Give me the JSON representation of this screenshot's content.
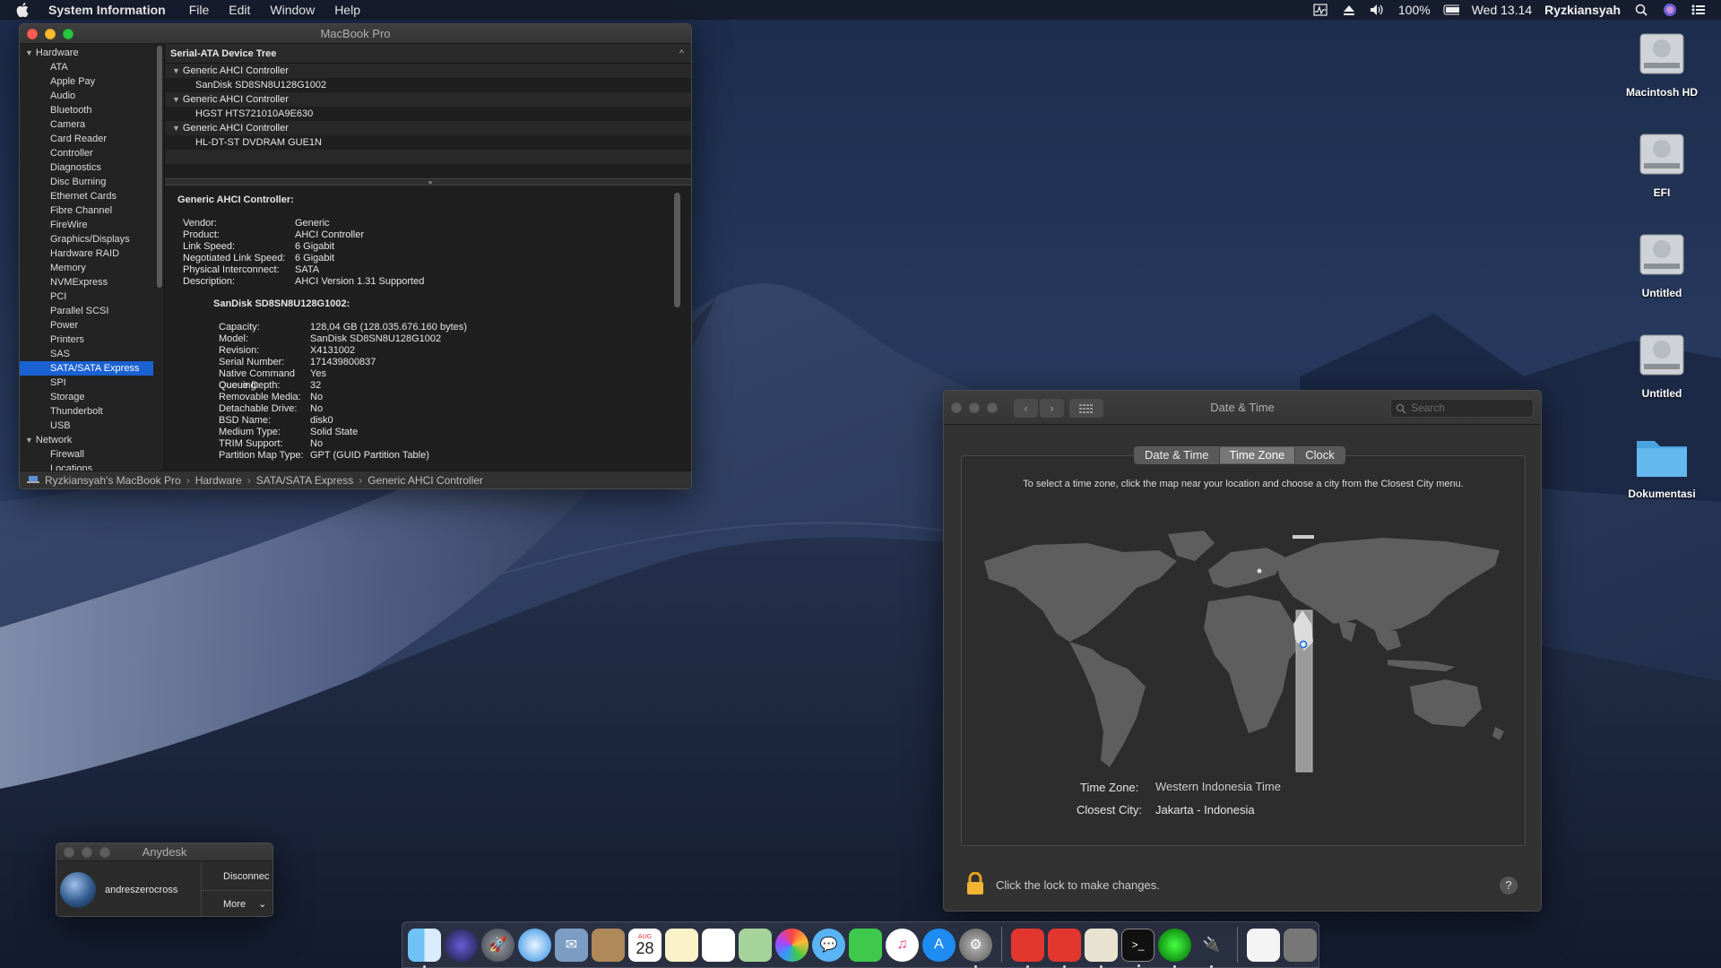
{
  "menubar": {
    "app_name": "System Information",
    "menus": [
      "File",
      "Edit",
      "Window",
      "Help"
    ],
    "battery": "100%",
    "clock": "Wed 13.14",
    "user": "Ryzkiansyah"
  },
  "sysinfo": {
    "title": "MacBook Pro",
    "sidebar": {
      "hardware_label": "Hardware",
      "hardware_items": [
        "ATA",
        "Apple Pay",
        "Audio",
        "Bluetooth",
        "Camera",
        "Card Reader",
        "Controller",
        "Diagnostics",
        "Disc Burning",
        "Ethernet Cards",
        "Fibre Channel",
        "FireWire",
        "Graphics/Displays",
        "Hardware RAID",
        "Memory",
        "NVMExpress",
        "PCI",
        "Parallel SCSI",
        "Power",
        "Printers",
        "SAS",
        "SATA/SATA Express",
        "SPI",
        "Storage",
        "Thunderbolt",
        "USB"
      ],
      "selected": "SATA/SATA Express",
      "network_label": "Network",
      "network_items": [
        "Firewall",
        "Locations"
      ]
    },
    "tree": {
      "header": "Serial-ATA Device Tree",
      "rows": [
        {
          "label": "Generic AHCI Controller",
          "child": false
        },
        {
          "label": "SanDisk SD8SN8U128G1002",
          "child": true
        },
        {
          "label": "Generic AHCI Controller",
          "child": false
        },
        {
          "label": "HGST HTS721010A9E630",
          "child": true
        },
        {
          "label": "Generic AHCI Controller",
          "child": false
        },
        {
          "label": "HL-DT-ST DVDRAM GUE1N",
          "child": true
        }
      ]
    },
    "detail": {
      "title": "Generic AHCI Controller:",
      "controller": [
        {
          "k": "Vendor:",
          "v": "Generic"
        },
        {
          "k": "Product:",
          "v": "AHCI Controller"
        },
        {
          "k": "Link Speed:",
          "v": "6 Gigabit"
        },
        {
          "k": "Negotiated Link Speed:",
          "v": "6 Gigabit"
        },
        {
          "k": "Physical Interconnect:",
          "v": "SATA"
        },
        {
          "k": "Description:",
          "v": "AHCI Version 1.31 Supported"
        }
      ],
      "device_title": "SanDisk SD8SN8U128G1002:",
      "device": [
        {
          "k": "Capacity:",
          "v": "128,04 GB (128.035.676.160 bytes)"
        },
        {
          "k": "Model:",
          "v": "SanDisk SD8SN8U128G1002"
        },
        {
          "k": "Revision:",
          "v": "X4131002"
        },
        {
          "k": "Serial Number:",
          "v": "171439800837"
        },
        {
          "k": "Native Command Queuing:",
          "v": "Yes"
        },
        {
          "k": "Queue Depth:",
          "v": "32"
        },
        {
          "k": "Removable Media:",
          "v": "No"
        },
        {
          "k": "Detachable Drive:",
          "v": "No"
        },
        {
          "k": "BSD Name:",
          "v": "disk0"
        },
        {
          "k": "Medium Type:",
          "v": "Solid State"
        },
        {
          "k": "TRIM Support:",
          "v": "No"
        },
        {
          "k": "Partition Map Type:",
          "v": "GPT (GUID Partition Table)"
        }
      ]
    },
    "path": [
      "Ryzkiansyah's MacBook Pro",
      "Hardware",
      "SATA/SATA Express",
      "Generic AHCI Controller"
    ]
  },
  "datetime": {
    "title": "Date & Time",
    "search_placeholder": "Search",
    "tabs": [
      "Date & Time",
      "Time Zone",
      "Clock"
    ],
    "active_tab": "Time Zone",
    "instruction": "To select a time zone, click the map near your location and choose a city from the Closest City menu.",
    "time_zone_label": "Time Zone:",
    "time_zone_value": "Western Indonesia Time",
    "closest_city_label": "Closest City:",
    "closest_city_value": "Jakarta - Indonesia",
    "lock_text": "Click the lock to make changes.",
    "help": "?"
  },
  "anydesk": {
    "title": "Anydesk",
    "user": "andreszerocross",
    "disconnect": "Disconnec",
    "more": "More"
  },
  "desktop_icons": [
    "Macintosh HD",
    "EFI",
    "Untitled",
    "Untitled",
    "Dokumentasi"
  ],
  "dock": {
    "calendar_month": "AUG",
    "calendar_day": "28"
  }
}
